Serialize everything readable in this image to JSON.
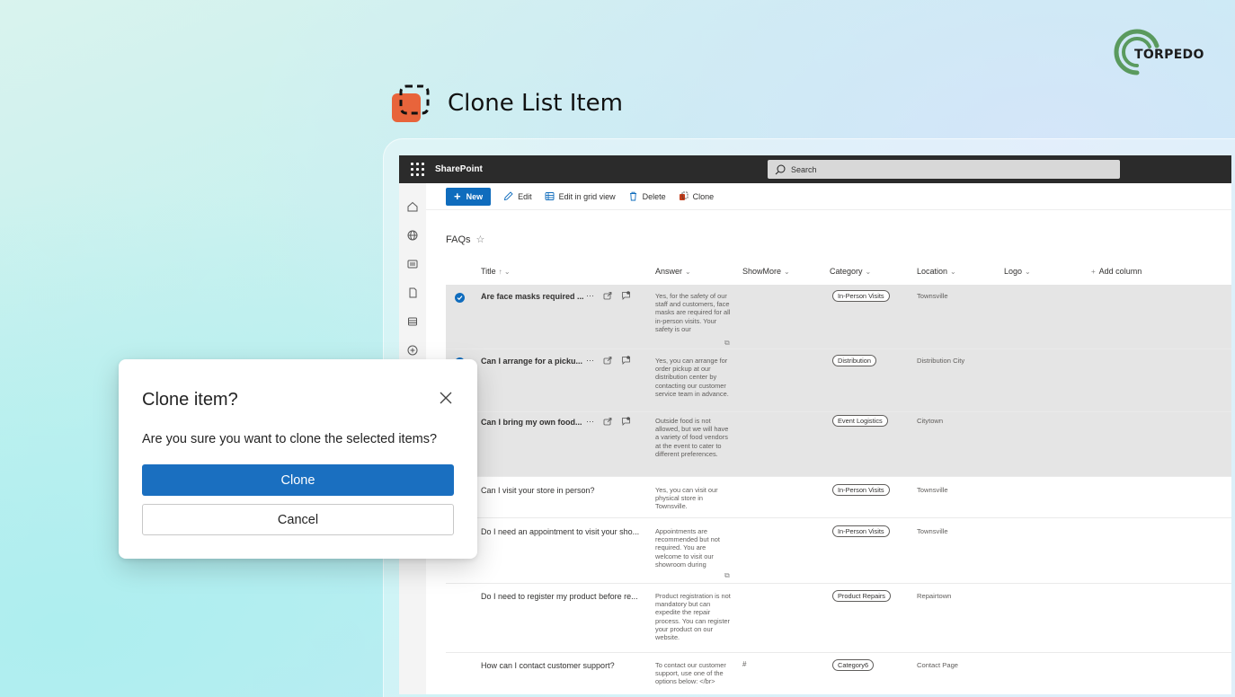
{
  "brand": {
    "logo_text": "TORPEDO",
    "accent": "#5a9a5e"
  },
  "hero": {
    "title": "Clone List Item",
    "icon_color": "#e8643b"
  },
  "app": {
    "name": "SharePoint",
    "search_placeholder": "Search",
    "commands": {
      "new": "New",
      "edit": "Edit",
      "grid": "Edit in grid view",
      "delete": "Delete",
      "clone": "Clone"
    },
    "list_title": "FAQs",
    "columns": {
      "title": "Title",
      "answer": "Answer",
      "showmore": "ShowMore",
      "category": "Category",
      "location": "Location",
      "logo": "Logo",
      "add": "Add column"
    },
    "rows": [
      {
        "title": "Are face masks required ...",
        "answer": "Yes, for the safety of our staff and customers, face masks are required for all in-person visits. Your safety is our",
        "showmore": "",
        "category": "In-Person Visits",
        "location": "Townsville",
        "selected": true
      },
      {
        "title": "Can I arrange for a picku...",
        "answer": "Yes, you can arrange for order pickup at our distribution center by contacting our customer service team in advance.",
        "showmore": "",
        "category": "Distribution",
        "location": "Distribution City",
        "selected": true
      },
      {
        "title": "Can I bring my own food...",
        "answer": "Outside food is not allowed, but we will have a variety of food vendors at the event to cater to different preferences.",
        "showmore": "",
        "category": "Event Logistics",
        "location": "Citytown",
        "selected": true
      },
      {
        "title": "Can I visit your store in person?",
        "answer": "Yes, you can visit our physical store in Townsville.",
        "showmore": "",
        "category": "In-Person Visits",
        "location": "Townsville",
        "selected": false
      },
      {
        "title": "Do I need an appointment to visit your sho...",
        "answer": "Appointments are recommended but not required. You are welcome to visit our showroom during",
        "showmore": "",
        "category": "In-Person Visits",
        "location": "Townsville",
        "selected": false
      },
      {
        "title": "Do I need to register my product before re...",
        "answer": "Product registration is not mandatory but can expedite the repair process. You can register your product on our website.",
        "showmore": "",
        "category": "Product Repairs",
        "location": "Repairtown",
        "selected": false
      },
      {
        "title": "How can I contact customer support?",
        "answer": "To contact our customer support, use one of the options below: </br>",
        "showmore": "#",
        "category": "Category6",
        "location": "Contact Page",
        "selected": false
      }
    ]
  },
  "dialog": {
    "title": "Clone item?",
    "message": "Are you sure you want to clone the selected items?",
    "primary": "Clone",
    "secondary": "Cancel"
  }
}
